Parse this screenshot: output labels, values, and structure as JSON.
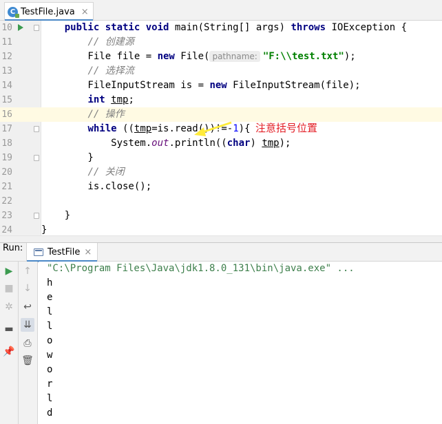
{
  "editor_tab": {
    "label": "TestFile.java",
    "icon": "java-class-icon",
    "close": "×"
  },
  "editor": {
    "lines": [
      {
        "num": "10",
        "parts": [
          [
            "    ",
            ""
          ],
          [
            "public static void",
            "kw"
          ],
          [
            " main(String[] args) ",
            ""
          ],
          [
            "throws",
            "kw"
          ],
          [
            " IOException {",
            ""
          ]
        ]
      },
      {
        "num": "11",
        "parts": [
          [
            "        ",
            ""
          ],
          [
            "// 创建源",
            "cm"
          ]
        ]
      },
      {
        "num": "12",
        "parts": [
          [
            "        File file = ",
            ""
          ],
          [
            "new",
            "kw"
          ],
          [
            " File(",
            ""
          ],
          [
            "pathname:",
            "hint"
          ],
          [
            "\"F:\\\\test.txt\"",
            "str"
          ],
          [
            ");",
            ""
          ]
        ]
      },
      {
        "num": "13",
        "parts": [
          [
            "        ",
            ""
          ],
          [
            "// 选择流",
            "cm"
          ]
        ]
      },
      {
        "num": "14",
        "parts": [
          [
            "        FileInputStream is = ",
            ""
          ],
          [
            "new",
            "kw"
          ],
          [
            " FileInputStream(file);",
            ""
          ]
        ]
      },
      {
        "num": "15",
        "parts": [
          [
            "        ",
            ""
          ],
          [
            "int",
            "kw"
          ],
          [
            " ",
            ""
          ],
          [
            "tmp",
            "uline"
          ],
          [
            ";",
            ""
          ]
        ]
      },
      {
        "num": "16",
        "parts": [
          [
            "        ",
            ""
          ],
          [
            "// 操作",
            "cm"
          ]
        ]
      },
      {
        "num": "17",
        "parts": [
          [
            "        ",
            ""
          ],
          [
            "while",
            "kw"
          ],
          [
            " ((",
            ""
          ],
          [
            "tmp",
            "uline"
          ],
          [
            "=is.read())!=-",
            ""
          ],
          [
            "1",
            "num"
          ],
          [
            "){",
            ""
          ]
        ]
      },
      {
        "num": "18",
        "parts": [
          [
            "            System.",
            ""
          ],
          [
            "out",
            "fld"
          ],
          [
            ".println((",
            ""
          ],
          [
            "char",
            "kw"
          ],
          [
            ") ",
            ""
          ],
          [
            "tmp",
            "uline"
          ],
          [
            ");",
            ""
          ]
        ]
      },
      {
        "num": "19",
        "parts": [
          [
            "        }",
            ""
          ]
        ]
      },
      {
        "num": "20",
        "parts": [
          [
            "        ",
            ""
          ],
          [
            "// 关闭",
            "cm"
          ]
        ]
      },
      {
        "num": "21",
        "parts": [
          [
            "        is.close();",
            ""
          ]
        ]
      },
      {
        "num": "22",
        "parts": []
      },
      {
        "num": "23",
        "parts": [
          [
            "    }",
            ""
          ]
        ]
      },
      {
        "num": "24",
        "parts": [
          [
            "}",
            ""
          ]
        ]
      }
    ],
    "annotation": "注意括号位置",
    "arrow_color": "#ffeb3b"
  },
  "run_window": {
    "title": "Run:",
    "tab_label": "TestFile",
    "tab_close": "×",
    "console_lines": [
      "\"C:\\Program Files\\Java\\jdk1.8.0_131\\bin\\java.exe\" ...",
      "h",
      "e",
      "l",
      "l",
      "o",
      "w",
      "o",
      "r",
      "l",
      "d"
    ],
    "left_toolbar": [
      {
        "name": "rerun-icon",
        "glyph": "▶",
        "color": "#3c9b50"
      },
      {
        "name": "stop-icon",
        "glyph": "■",
        "color": "#c4c4c4"
      },
      {
        "name": "settings-icon",
        "glyph": "✲",
        "color": "#b5b5b5"
      },
      {
        "name": "layout-icon",
        "glyph": "▬",
        "color": "#555555"
      },
      {
        "name": "pin-icon",
        "glyph": "📌",
        "color": "#555555"
      }
    ],
    "right_toolbar": [
      {
        "name": "scroll-up-icon",
        "glyph": "↑",
        "color": "#b5b5b5"
      },
      {
        "name": "scroll-down-icon",
        "glyph": "↓",
        "color": "#b5b5b5"
      },
      {
        "name": "soft-wrap-icon",
        "glyph": "↩",
        "color": "#555555"
      },
      {
        "name": "scroll-to-end-icon",
        "glyph": "⇊",
        "color": "#555555"
      },
      {
        "name": "print-icon",
        "glyph": "⎙",
        "color": "#555555"
      },
      {
        "name": "clear-icon",
        "glyph": "🗑",
        "color": "#555555"
      }
    ]
  }
}
